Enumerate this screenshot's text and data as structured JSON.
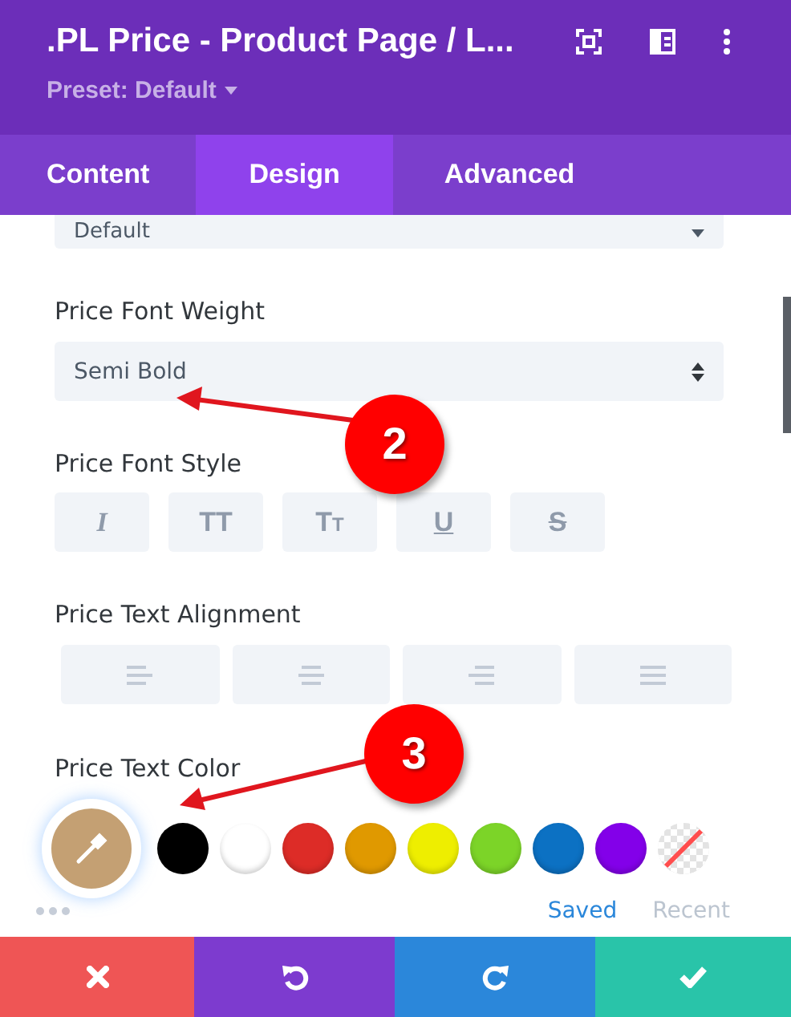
{
  "header": {
    "title": ".PL Price - Product Page / L...",
    "preset": "Preset: Default"
  },
  "tabs": [
    {
      "label": "Content",
      "selected": false
    },
    {
      "label": "Design",
      "selected": true
    },
    {
      "label": "Advanced",
      "selected": false
    }
  ],
  "top_select": {
    "value": "Default"
  },
  "font_weight": {
    "label": "Price Font Weight",
    "value": "Semi Bold"
  },
  "font_style": {
    "label": "Price Font Style",
    "buttons": [
      {
        "kind": "italic",
        "label": "I"
      },
      {
        "kind": "uppercase",
        "label": "TT"
      },
      {
        "kind": "capitalize",
        "label": "Tt"
      },
      {
        "kind": "underline",
        "label": "U"
      },
      {
        "kind": "strikethrough",
        "label": "S"
      }
    ]
  },
  "alignment": {
    "label": "Price Text Alignment",
    "buttons": [
      {
        "kind": "left"
      },
      {
        "kind": "center"
      },
      {
        "kind": "right"
      },
      {
        "kind": "justify"
      }
    ]
  },
  "text_color": {
    "label": "Price Text Color",
    "picker": {
      "color": "#c4a073"
    },
    "swatches": [
      {
        "kind": "color",
        "color": "#000000"
      },
      {
        "kind": "color",
        "color": "#ffffff"
      },
      {
        "kind": "color",
        "color": "#dd2c27"
      },
      {
        "kind": "color",
        "color": "#e09900"
      },
      {
        "kind": "color",
        "color": "#eeee00"
      },
      {
        "kind": "color",
        "color": "#7cd428"
      },
      {
        "kind": "color",
        "color": "#0c71c3"
      },
      {
        "kind": "color",
        "color": "#8300e9"
      },
      {
        "kind": "none"
      }
    ],
    "tabs": [
      {
        "label": "Saved",
        "selected": true
      },
      {
        "label": "Recent",
        "selected": false
      }
    ]
  },
  "annotations": [
    {
      "label": "2"
    },
    {
      "label": "3"
    }
  ],
  "footer_buttons": [
    {
      "kind": "cancel"
    },
    {
      "kind": "undo"
    },
    {
      "kind": "redo"
    },
    {
      "kind": "save"
    }
  ]
}
